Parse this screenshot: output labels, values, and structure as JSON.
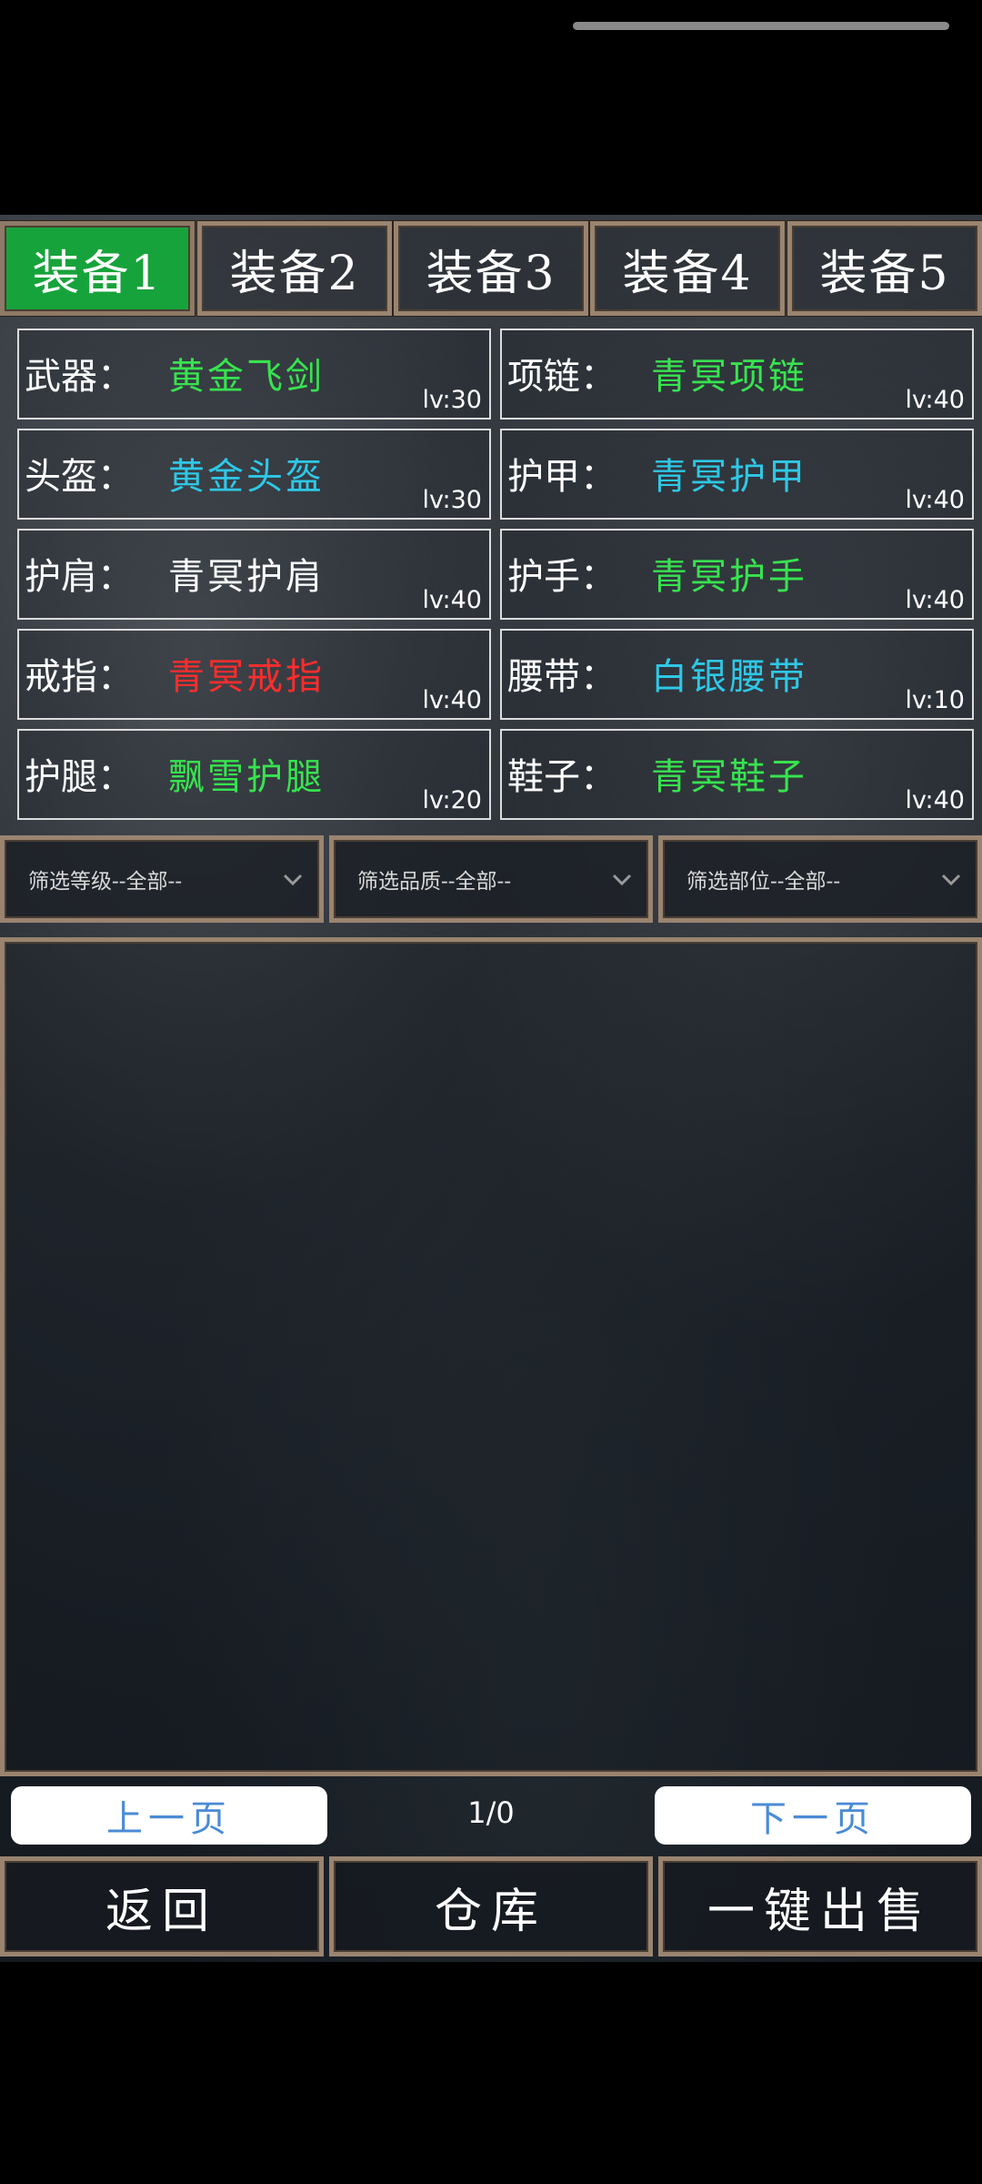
{
  "tabs": [
    {
      "label": "装备1"
    },
    {
      "label": "装备2"
    },
    {
      "label": "装备3"
    },
    {
      "label": "装备4"
    },
    {
      "label": "装备5"
    }
  ],
  "active_tab": 0,
  "slots": [
    {
      "label": "武器：",
      "name": "黄金飞剑",
      "level": "lv:30",
      "color": "#37e34f"
    },
    {
      "label": "项链：",
      "name": "青冥项链",
      "level": "lv:40",
      "color": "#37e34f"
    },
    {
      "label": "头盔：",
      "name": "黄金头盔",
      "level": "lv:30",
      "color": "#2ec8e6"
    },
    {
      "label": "护甲：",
      "name": "青冥护甲",
      "level": "lv:40",
      "color": "#2ec8e6"
    },
    {
      "label": "护肩：",
      "name": "青冥护肩",
      "level": "lv:40",
      "color": "#ffffff"
    },
    {
      "label": "护手：",
      "name": "青冥护手",
      "level": "lv:40",
      "color": "#37e34f"
    },
    {
      "label": "戒指：",
      "name": "青冥戒指",
      "level": "lv:40",
      "color": "#ff2d2d"
    },
    {
      "label": "腰带：",
      "name": "白银腰带",
      "level": "lv:10",
      "color": "#2ec8e6"
    },
    {
      "label": "护腿：",
      "name": "飘雪护腿",
      "level": "lv:20",
      "color": "#37e34f"
    },
    {
      "label": "鞋子：",
      "name": "青冥鞋子",
      "level": "lv:40",
      "color": "#37e34f"
    }
  ],
  "filters": {
    "level": "筛选等级--全部--",
    "quality": "筛选品质--全部--",
    "part": "筛选部位--全部--"
  },
  "pager": {
    "prev": "上一页",
    "next": "下一页",
    "indicator": "1/0"
  },
  "actions": {
    "back": "返回",
    "warehouse": "仓库",
    "sell_all": "一键出售"
  },
  "colors": {
    "active_tab": "#17a33b",
    "frame": "#9a8470",
    "pager_text": "#4a8bd6"
  }
}
